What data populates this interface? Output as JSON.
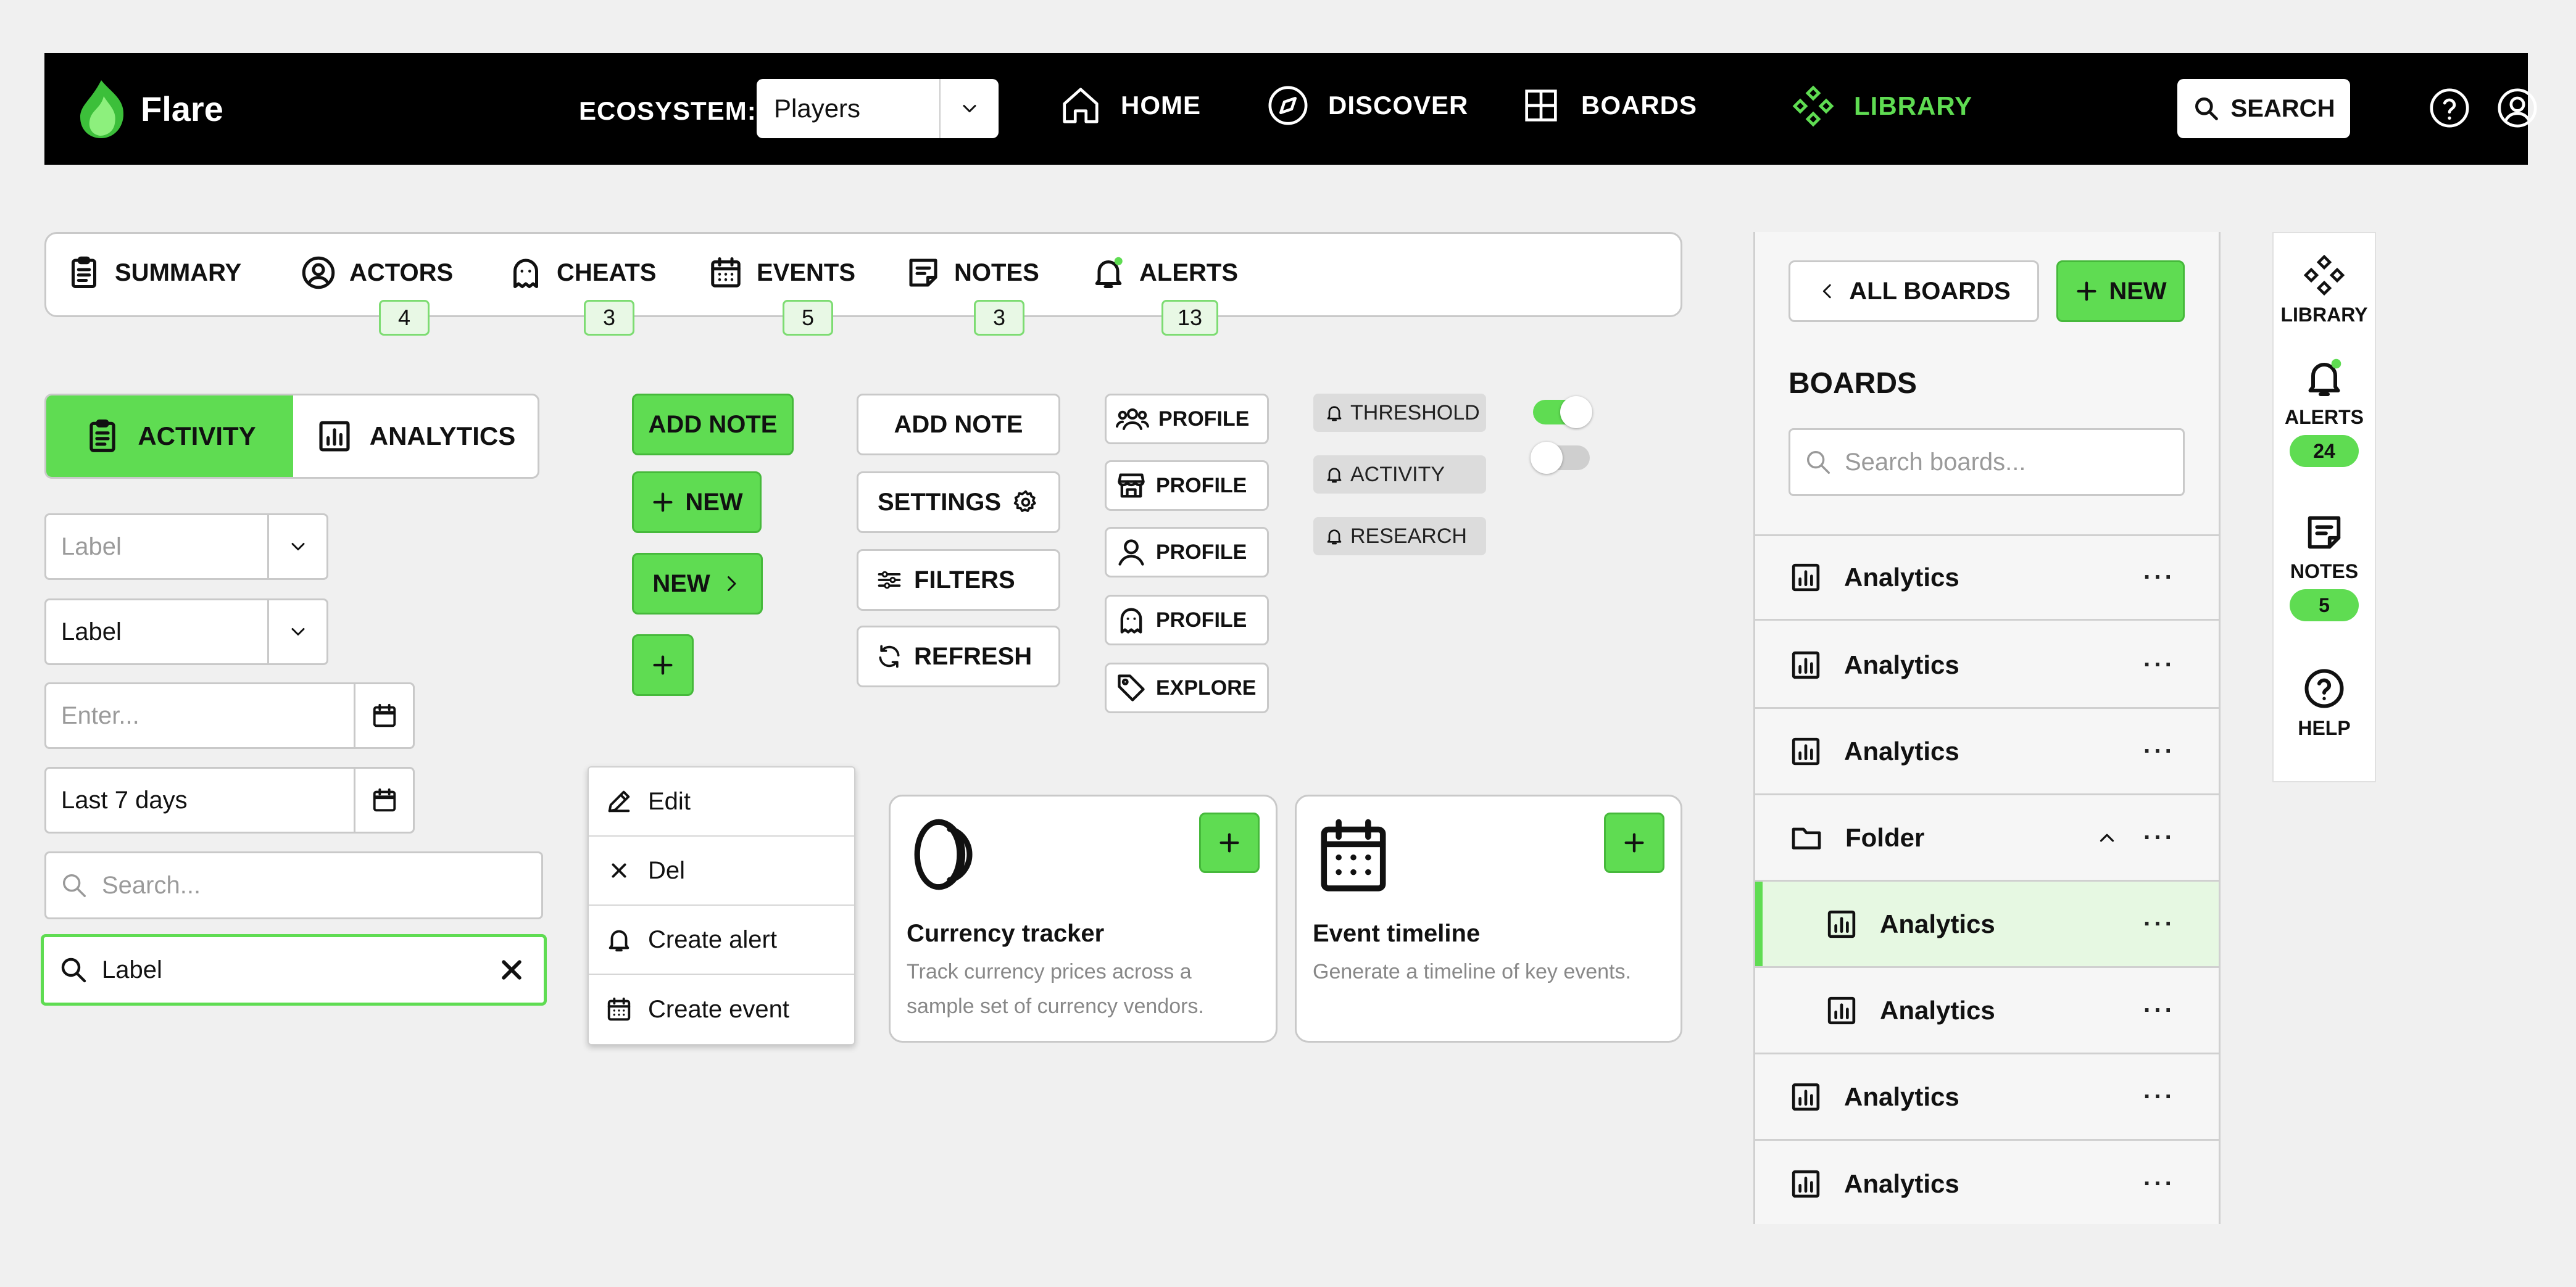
{
  "nav": {
    "brand": "Flare",
    "ecosystem_label": "ECOSYSTEM:",
    "ecosystem_value": "Players",
    "links": [
      {
        "label": "HOME",
        "icon": "home-icon"
      },
      {
        "label": "DISCOVER",
        "icon": "compass-icon"
      },
      {
        "label": "BOARDS",
        "icon": "grid-icon"
      },
      {
        "label": "LIBRARY",
        "icon": "library-icon",
        "active": true
      }
    ],
    "search_label": "SEARCH",
    "accent_color": "#5fdc52"
  },
  "tabs": [
    {
      "label": "SUMMARY",
      "icon": "clipboard-icon"
    },
    {
      "label": "ACTORS",
      "icon": "user-circle-icon",
      "count": "4"
    },
    {
      "label": "CHEATS",
      "icon": "ghost-icon",
      "count": "3"
    },
    {
      "label": "EVENTS",
      "icon": "calendar-icon",
      "count": "5"
    },
    {
      "label": "NOTES",
      "icon": "note-icon",
      "count": "3"
    },
    {
      "label": "ALERTS",
      "icon": "bell-icon",
      "count": "13"
    }
  ],
  "segmented": {
    "active": "ACTIVITY",
    "inactive": "ANALYTICS"
  },
  "inputs": {
    "select_placeholder": "Label",
    "select_value": "Label",
    "date_placeholder": "Enter...",
    "date_value": "Last 7 days",
    "search_placeholder": "Search...",
    "search_value": "Label"
  },
  "buttons": {
    "add_note_green": "ADD NOTE",
    "new_green": "NEW",
    "new_arrow_green": "NEW",
    "add_note_outline": "ADD NOTE",
    "settings": "SETTINGS",
    "filters": "FILTERS",
    "refresh": "REFRESH"
  },
  "profile_buttons": [
    {
      "label": "PROFILE",
      "icon": "users-icon"
    },
    {
      "label": "PROFILE",
      "icon": "store-icon"
    },
    {
      "label": "PROFILE",
      "icon": "user-icon"
    },
    {
      "label": "PROFILE",
      "icon": "ghost-icon"
    },
    {
      "label": "EXPLORE",
      "icon": "tag-icon"
    }
  ],
  "chips": [
    "THRESHOLD",
    "ACTIVITY",
    "RESEARCH"
  ],
  "toggles": [
    {
      "state": "on"
    },
    {
      "state": "off"
    }
  ],
  "context_menu": [
    "Edit",
    "Del",
    "Create alert",
    "Create event"
  ],
  "cards": [
    {
      "title": "Currency tracker",
      "desc_lines": [
        "Track currency prices across a",
        "sample set of currency vendors."
      ]
    },
    {
      "title": "Event timeline",
      "desc_lines": [
        "Generate a timeline of key events."
      ]
    }
  ],
  "boards_panel": {
    "back_label": "ALL BOARDS",
    "new_label": "NEW",
    "title": "BOARDS",
    "search_placeholder": "Search boards...",
    "rows": [
      {
        "label": "Analytics",
        "type": "chart"
      },
      {
        "label": "Analytics",
        "type": "chart"
      },
      {
        "label": "Analytics",
        "type": "chart"
      },
      {
        "label": "Folder",
        "type": "folder",
        "expanded": true
      },
      {
        "label": "Analytics",
        "type": "chart",
        "nested": true,
        "selected": true
      },
      {
        "label": "Analytics",
        "type": "chart",
        "nested": true
      },
      {
        "label": "Analytics",
        "type": "chart"
      },
      {
        "label": "Analytics",
        "type": "chart"
      }
    ],
    "more": "···"
  },
  "rail": [
    {
      "label": "LIBRARY",
      "icon": "library-icon"
    },
    {
      "label": "ALERTS",
      "icon": "bell-icon",
      "count": "24"
    },
    {
      "label": "NOTES",
      "icon": "note-icon",
      "count": "5"
    },
    {
      "label": "HELP",
      "icon": "help-icon"
    }
  ]
}
